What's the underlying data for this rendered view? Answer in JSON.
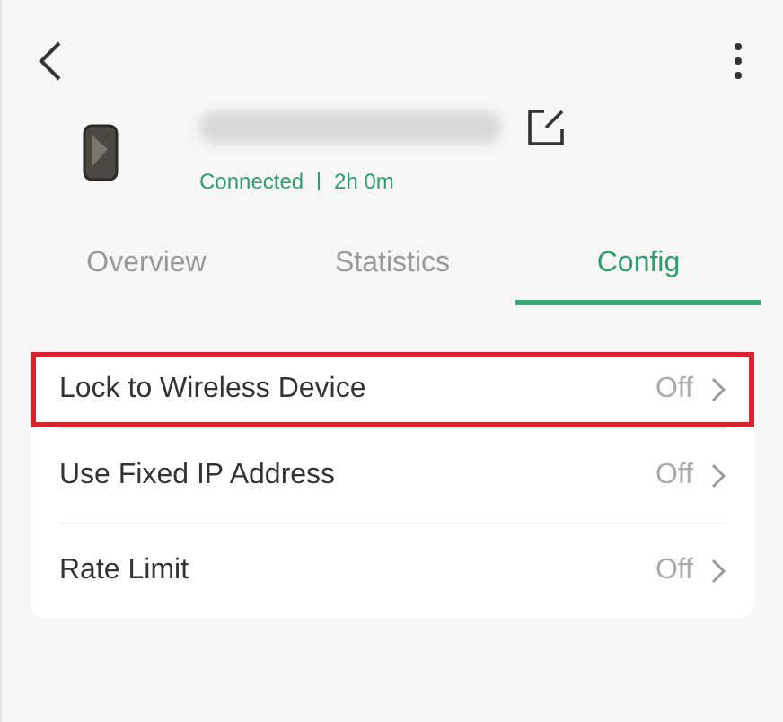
{
  "status": {
    "state": "Connected",
    "duration": "2h 0m"
  },
  "tabs": [
    {
      "label": "Overview",
      "selected": false
    },
    {
      "label": "Statistics",
      "selected": false
    },
    {
      "label": "Config",
      "selected": true
    }
  ],
  "settings": [
    {
      "label": "Lock to Wireless Device",
      "value": "Off",
      "highlighted": true
    },
    {
      "label": "Use Fixed IP Address",
      "value": "Off",
      "highlighted": false
    },
    {
      "label": "Rate Limit",
      "value": "Off",
      "highlighted": false
    }
  ]
}
